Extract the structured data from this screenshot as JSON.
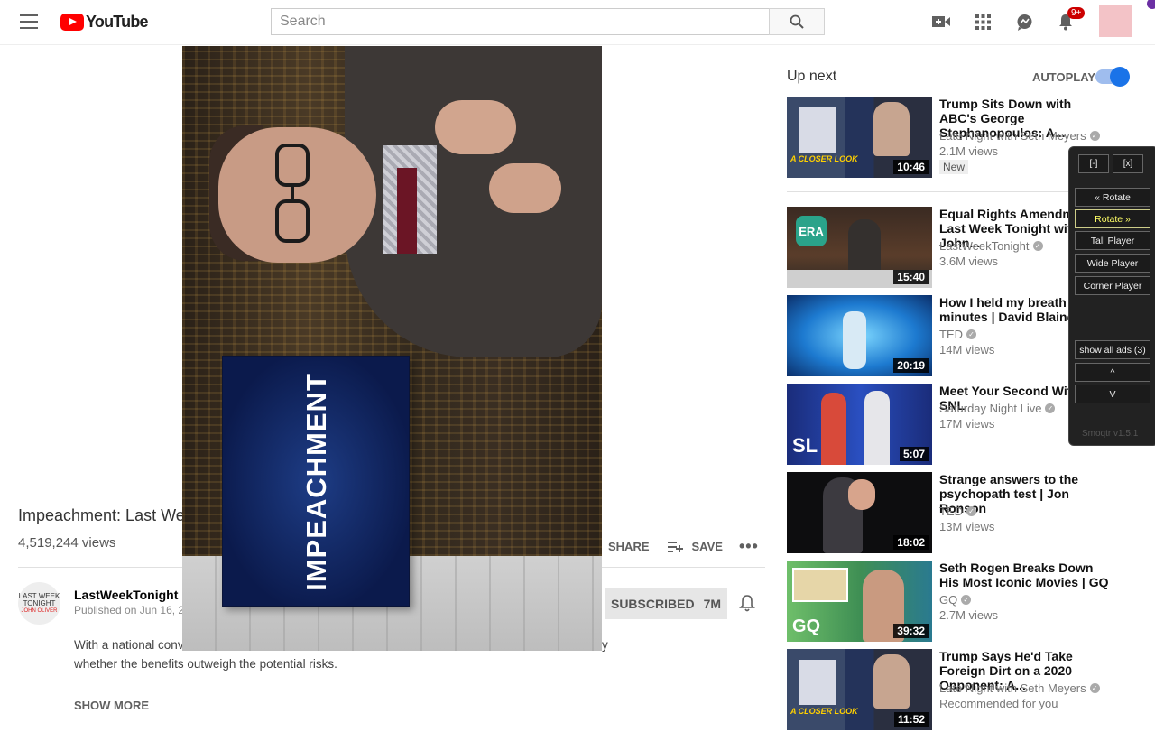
{
  "masthead": {
    "logo_text": "YouTube",
    "search_placeholder": "Search",
    "notification_count": "9+"
  },
  "player": {
    "overlay_text": "IMPEACHMENT"
  },
  "video": {
    "title": "Impeachment: Last Week Tonight with John Oliver (HBO)",
    "views": "4,519,244 views",
    "share_label": "SHARE",
    "save_label": "SAVE",
    "channel": "LastWeekTonight",
    "channel_avatar_lines": [
      "LAST WEEK",
      "TONIGHT",
      "JOHN OLIVER"
    ],
    "published": "Published on Jun 16, 2019",
    "subscribe_label": "SUBSCRIBED",
    "subscriber_count": "7M",
    "description_line1_start": "With a national conv",
    "description_line1_end": "y",
    "description_line2": "whether the benefits outweigh the potential risks.",
    "show_more": "SHOW MORE"
  },
  "sidebar": {
    "up_next": "Up next",
    "autoplay_label": "AUTOPLAY",
    "autoplay_on": true,
    "videos": [
      {
        "title": "Trump Sits Down with ABC's George Stephanopoulos: A...",
        "channel": "Late Night with Seth Meyers",
        "verified": true,
        "meta": "2.1M views",
        "badge": "New",
        "duration": "10:46",
        "thumb_caption": "A CLOSER LOOK"
      },
      {
        "title": "Equal Rights Amendment: Last Week Tonight with John...",
        "channel": "LastWeekTonight",
        "verified": true,
        "meta": "3.6M views",
        "duration": "15:40",
        "thumb_caption": "ERA"
      },
      {
        "title": "How I held my breath for 17 minutes | David Blaine",
        "channel": "TED",
        "verified": true,
        "meta": "14M views",
        "duration": "20:19"
      },
      {
        "title": "Meet Your Second Wife - SNL",
        "channel": "Saturday Night Live",
        "verified": true,
        "meta": "17M views",
        "duration": "5:07",
        "thumb_caption": "SL"
      },
      {
        "title": "Strange answers to the psychopath test | Jon Ronson",
        "channel": "TED",
        "verified": true,
        "meta": "13M views",
        "duration": "18:02"
      },
      {
        "title": "Seth Rogen Breaks Down His Most Iconic Movies | GQ",
        "channel": "GQ",
        "verified": true,
        "meta": "2.7M views",
        "duration": "39:32",
        "thumb_caption": "GQ"
      },
      {
        "title": "Trump Says He'd Take Foreign Dirt on a 2020 Opponent: A...",
        "channel": "Late Night with Seth Meyers",
        "verified": true,
        "meta": "Recommended for you",
        "duration": "11:52",
        "thumb_caption": "A CLOSER LOOK"
      }
    ]
  },
  "tool_panel": {
    "small_buttons": [
      "[-]",
      "[x]"
    ],
    "buttons": [
      "« Rotate",
      "Rotate »",
      "Tall Player",
      "Wide Player",
      "Corner Player"
    ],
    "active_button": "Rotate »",
    "ads_label": "show all ads (3)",
    "up_label": "^",
    "down_label": "V",
    "version": "Smoqtr v1.5.1"
  },
  "colors": {
    "brand_red": "#ff0000",
    "autoplay_blue": "#1a73e8",
    "tool_active": "#ffff66"
  }
}
